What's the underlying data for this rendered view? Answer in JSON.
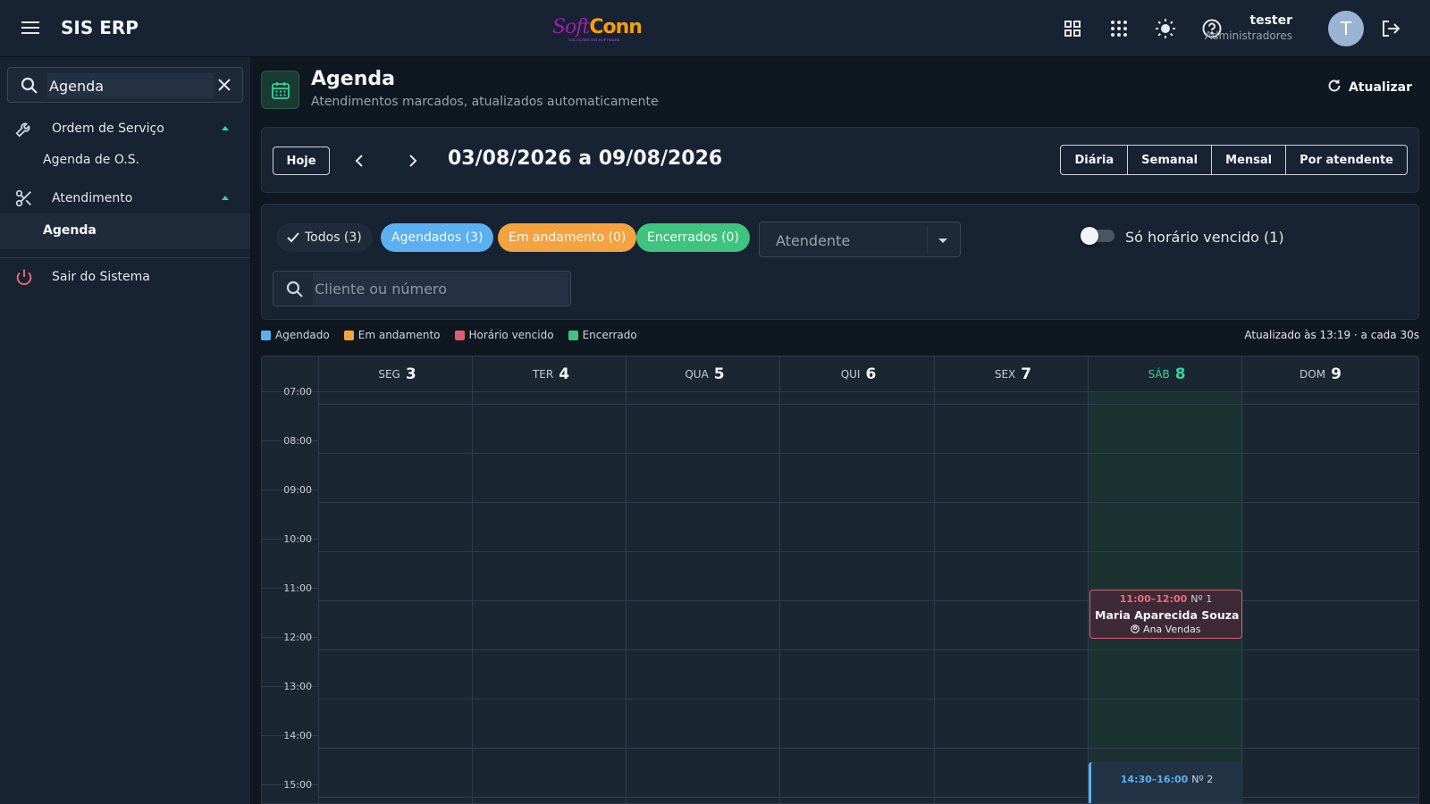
{
  "topbar": {
    "app_title": "SIS ERP",
    "brand": {
      "part1": "Soft",
      "part2": "Conn",
      "tagline": "SOLUÇÕES EM SOFTWARE"
    },
    "icons": [
      "apps-grid-icon",
      "app-launcher-icon",
      "theme-sun-icon",
      "help-icon",
      "logout-icon"
    ],
    "user": {
      "name": "tester",
      "role": "Administradores",
      "avatar_letter": "T"
    }
  },
  "sidebar": {
    "search_value": "Agenda",
    "items": [
      {
        "label": "Ordem de Serviço",
        "icon": "wrench-icon",
        "expanded": true,
        "children": [
          {
            "label": "Agenda de O.S."
          }
        ]
      },
      {
        "label": "Atendimento",
        "icon": "scissors-icon",
        "expanded": true,
        "children": [
          {
            "label": "Agenda",
            "active": true
          }
        ]
      },
      {
        "label": "Sair do Sistema",
        "icon": "power-icon"
      }
    ]
  },
  "header": {
    "title": "Agenda",
    "subtitle": "Atendimentos marcados, atualizados automaticamente",
    "refresh_label": "Atualizar"
  },
  "nav": {
    "today_label": "Hoje",
    "range": "03/08/2026 a 09/08/2026",
    "views": [
      "Diária",
      "Semanal",
      "Mensal",
      "Por atendente"
    ]
  },
  "filters": {
    "chips": {
      "all": "Todos (3)",
      "scheduled": "Agendados (3)",
      "in_progress": "Em andamento (0)",
      "closed": "Encerrados (0)"
    },
    "attendant_placeholder": "Atendente",
    "overdue_toggle_label": "Só horário vencido (1)",
    "overdue_toggle_on": false,
    "search_placeholder": "Cliente ou número"
  },
  "legend": {
    "items": [
      {
        "label": "Agendado",
        "color": "#5ab0f0"
      },
      {
        "label": "Em andamento",
        "color": "#f4a340"
      },
      {
        "label": "Horário vencido",
        "color": "#e05d6f"
      },
      {
        "label": "Encerrado",
        "color": "#3ec47e"
      }
    ],
    "updated": "Atualizado às 13:19 · a cada 30s"
  },
  "calendar": {
    "days": [
      {
        "dow": "SEG",
        "num": "3"
      },
      {
        "dow": "TER",
        "num": "4"
      },
      {
        "dow": "QUA",
        "num": "5"
      },
      {
        "dow": "QUI",
        "num": "6"
      },
      {
        "dow": "SEX",
        "num": "7"
      },
      {
        "dow": "SÁB",
        "num": "8",
        "today": true
      },
      {
        "dow": "DOM",
        "num": "9"
      }
    ],
    "times": [
      "07:00",
      "08:00",
      "09:00",
      "10:00",
      "11:00",
      "12:00",
      "13:00",
      "14:00",
      "15:00"
    ],
    "events": [
      {
        "time": "11:00–12:00",
        "number": "Nº 1",
        "client": "Maria Aparecida Souza",
        "attendant": "Ana Vendas",
        "status": "overdue"
      },
      {
        "time": "14:30–16:00",
        "number": "Nº 2",
        "status": "scheduled"
      }
    ]
  }
}
